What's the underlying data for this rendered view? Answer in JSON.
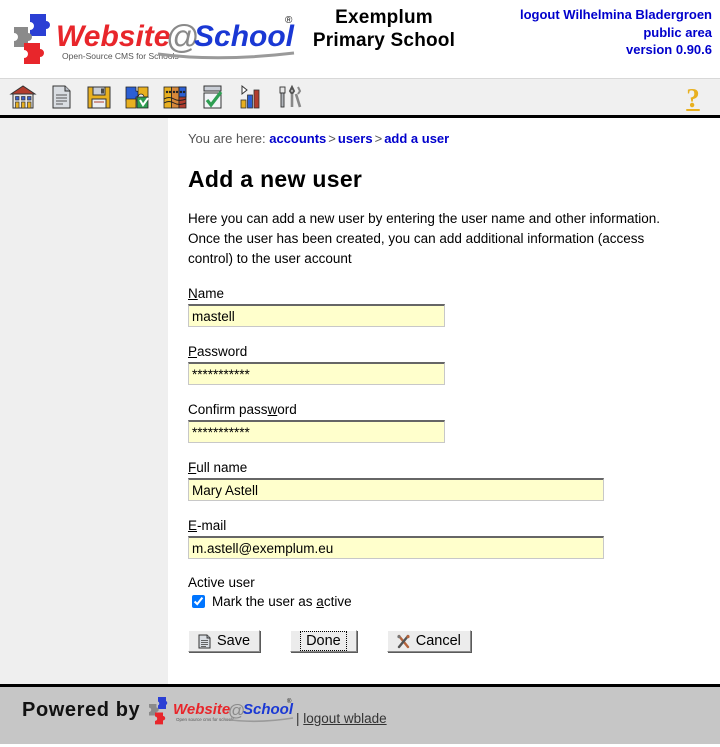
{
  "header": {
    "logo_alt": "Website@School",
    "logo_text_website": "Website",
    "logo_text_at": "@",
    "logo_text_school": "School",
    "logo_tagline": "Open-Source CMS for Schools",
    "logo_registered": "®",
    "school_name_line1": "Exemplum",
    "school_name_line2": "Primary School",
    "logout_line": "logout Wilhelmina Bladergroen",
    "area_line": "public area",
    "version_line": "version 0.90.6"
  },
  "toolbar": {
    "items": [
      {
        "name": "school-icon",
        "title": "School"
      },
      {
        "name": "page-icon",
        "title": "Page"
      },
      {
        "name": "save-disk-icon",
        "title": "File manager"
      },
      {
        "name": "modules-puzzle-icon",
        "title": "Modules"
      },
      {
        "name": "accounts-faces-icon",
        "title": "Accounts"
      },
      {
        "name": "pagemanager-check-icon",
        "title": "Page manager"
      },
      {
        "name": "statistics-chart-icon",
        "title": "Statistics"
      },
      {
        "name": "tools-icon",
        "title": "Tools"
      }
    ],
    "help_label": "?"
  },
  "breadcrumb": {
    "prefix": "You are here:",
    "items": [
      "accounts",
      "users",
      "add a user"
    ],
    "separator": ">"
  },
  "main": {
    "title": "Add a new user",
    "intro": "Here you can add a new user by entering the user name and other information. Once the user has been created, you can add additional information (access control) to the user account"
  },
  "form": {
    "name": {
      "label_accesskey": "N",
      "label_rest": "ame",
      "value": "mastell",
      "placeholder": ""
    },
    "password": {
      "label_accesskey": "P",
      "label_rest": "assword",
      "value": "***********",
      "placeholder": ""
    },
    "confirm_password": {
      "label_pre": "Confirm pass",
      "label_accesskey": "w",
      "label_rest": "ord",
      "value": "***********",
      "placeholder": ""
    },
    "full_name": {
      "label_accesskey": "F",
      "label_rest": "ull name",
      "value": "Mary Astell",
      "placeholder": ""
    },
    "email": {
      "label_accesskey": "E",
      "label_rest": "-mail",
      "value": "m.astell@exemplum.eu",
      "placeholder": ""
    },
    "active_user": {
      "group_label": "Active user",
      "checkbox_pre": "Mark the user as ",
      "checkbox_accesskey": "a",
      "checkbox_rest": "ctive",
      "checked": true
    }
  },
  "buttons": {
    "save": {
      "label": "Save",
      "icon": "document-icon",
      "focused": false
    },
    "done": {
      "label": "Done",
      "icon": "",
      "focused": true
    },
    "cancel": {
      "label": "Cancel",
      "icon": "crossed-tools-icon",
      "focused": false
    }
  },
  "footer": {
    "powered_by": "Powered by",
    "logo_text_website": "Website",
    "logo_text_at": "@",
    "logo_text_school": "School",
    "logo_tagline": "Open source cms for schools",
    "logo_registered": "®",
    "separator": "|",
    "logout_link": "logout wblade"
  },
  "colors": {
    "brand_red": "#e8262b",
    "brand_blue": "#1a38d4",
    "link_blue": "#0000cc",
    "field_bg": "#ffffcc",
    "sidebar_bg": "#efefef",
    "footer_bg": "#c6c6c6",
    "help_yellow": "#e8b020"
  }
}
